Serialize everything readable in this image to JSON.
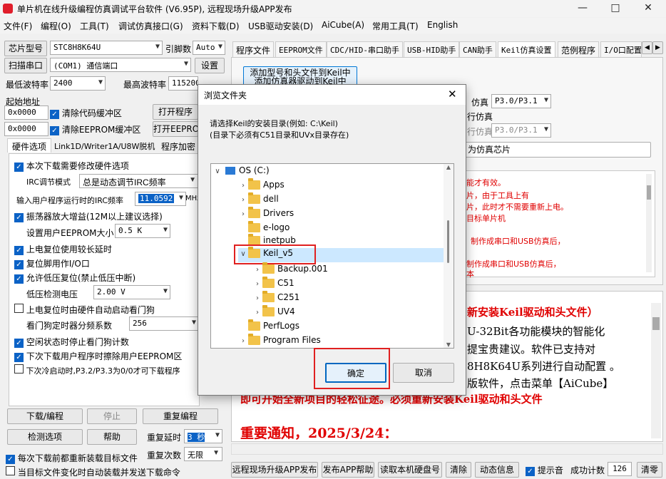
{
  "window": {
    "title": "单片机在线升级编程仿真调试平台软件 (V6.95P), 远程现场升级APP发布"
  },
  "menu": [
    "文件(F)",
    "编程(O)",
    "工具(T)",
    "调试仿真接口(G)",
    "资料下载(D)",
    "USB驱动安装(D)",
    "AiCube(A)",
    "常用工具(T)",
    "English"
  ],
  "left": {
    "chip_label": "芯片型号",
    "chip_value": "STC8H8K64U",
    "pin_label": "引脚数",
    "pin_value": "Auto",
    "scan_label": "扫描串口",
    "port_value": "(COM1) 通信端口",
    "settings_label": "设置",
    "min_baud_label": "最低波特率",
    "min_baud": "2400",
    "max_baud_label": "最高波特率",
    "max_baud": "115200",
    "start_addr_label": "起始地址",
    "addr1": "0x0000",
    "clear_code": "清除代码缓冲区",
    "open_prog": "打开程序",
    "addr2": "0x0000",
    "clear_eeprom": "清除EEPROM缓冲区",
    "open_eeprom": "打开EEPRO",
    "tabs": [
      "硬件选项",
      "Link1D/Writer1A/U8W脱机",
      "程序加密"
    ],
    "opt_modify": "本次下载需要修改硬件选项",
    "irc_mode_label": "IRC调节模式",
    "irc_mode": "总是动态调节IRC频率",
    "irc_freq_label": "输入用户程序运行时的IRC频率",
    "irc_freq": "11.0592",
    "irc_unit": "MHz",
    "osc_gain": "振荡器放大增益(12M以上建议选择)",
    "eeprom_size_label": "设置用户EEPROM大小",
    "eeprom_size": "0.5 K",
    "long_reset": "上电复位使用较长延时",
    "reset_io": "复位脚用作I/O口",
    "lvd_reset": "允许低压复位(禁止低压中断)",
    "lvd_label": "低压检测电压",
    "lvd_value": "2.00 V",
    "wdt_auto": "上电复位时由硬件自动启动看门狗",
    "wdt_div_label": "看门狗定时器分频系数",
    "wdt_div": "256",
    "idle_wdt": "空闲状态时停止看门狗计数",
    "erase_eeprom": "下次下载用户程序时擦除用户EEPROM区",
    "cold_start": "下次冷启动时,P3.2/P3.3为0/0才可下载程序",
    "download_btn": "下载/编程",
    "stop_btn": "停止",
    "reprogram_btn": "重复编程",
    "check_btn": "检测选项",
    "help_btn": "帮助",
    "repeat_delay_label": "重复延时",
    "repeat_delay": "3 秒",
    "repeat_count_label": "重复次数",
    "repeat_count": "无限",
    "reload_each": "每次下载前都重新装载目标文件",
    "reload_change": "当目标文件变化时自动装载并发送下载命令"
  },
  "right": {
    "tabs": [
      "程序文件",
      "EEPROM文件",
      "CDC/HID-串口助手",
      "USB-HID助手",
      "CAN助手",
      "Keil仿真设置",
      "范例程序",
      "I/O口配置"
    ],
    "add_keil_btn": "添加型号和头文件到Keil中",
    "add_keil_btn2": "添加仿真器驱动到Keil中",
    "sim_label1": "仿真",
    "sim_val1": "P3.0/P3.1",
    "sim_label2": "行仿真",
    "sim_label3": "行仿真",
    "sim_val3": "P3.0/P3.1",
    "sim_chip": "为仿真芯片",
    "notes": [
      "能才有效。",
      "片，由于工具上有",
      "片，此时才不需要重新上电。",
      "目标单片机",
      "制作成串口和USB仿真后，",
      "制作成串口和USB仿真后，",
      "本"
    ],
    "big1": "新安装Keil驱动和头文件）",
    "big2": "U-32Bit各功能模块的智能化",
    "big3": "提宝贵建议。软件已支持对",
    "big4": "8H8K64U系列进行自动配置 。",
    "big5": "版软件，点击菜单【AiCube】",
    "big6": "即可开始全新项目的轻松征途。必须重新安装Keil驱动和头文件",
    "big7": "重要通知，2025/3/24："
  },
  "bottom": {
    "remote_btn": "远程现场升级APP发布",
    "publish_btn": "发布APP帮助",
    "disk_btn": "读取本机硬盘号",
    "clear_btn": "清除",
    "anim_btn": "动态信息",
    "beep": "提示音",
    "count_label": "成功计数",
    "count": "126",
    "reset_btn": "清零"
  },
  "dialog": {
    "title": "浏览文件夹",
    "line1": "请选择Keil的安装目录(例如: C:\\Keil)",
    "line2": "(目录下必须有C51目录和UVx目录存在)",
    "tree": [
      "OS (C:)",
      "Apps",
      "dell",
      "Drivers",
      "e-logo",
      "inetpub",
      "Keil_v5",
      "Backup.001",
      "C51",
      "C251",
      "UV4",
      "PerfLogs",
      "Program Files"
    ],
    "ok": "确定",
    "cancel": "取消"
  },
  "colors": {
    "accent": "#0b62c6",
    "highlight": "#e02020",
    "selected": "#cce8ff"
  }
}
